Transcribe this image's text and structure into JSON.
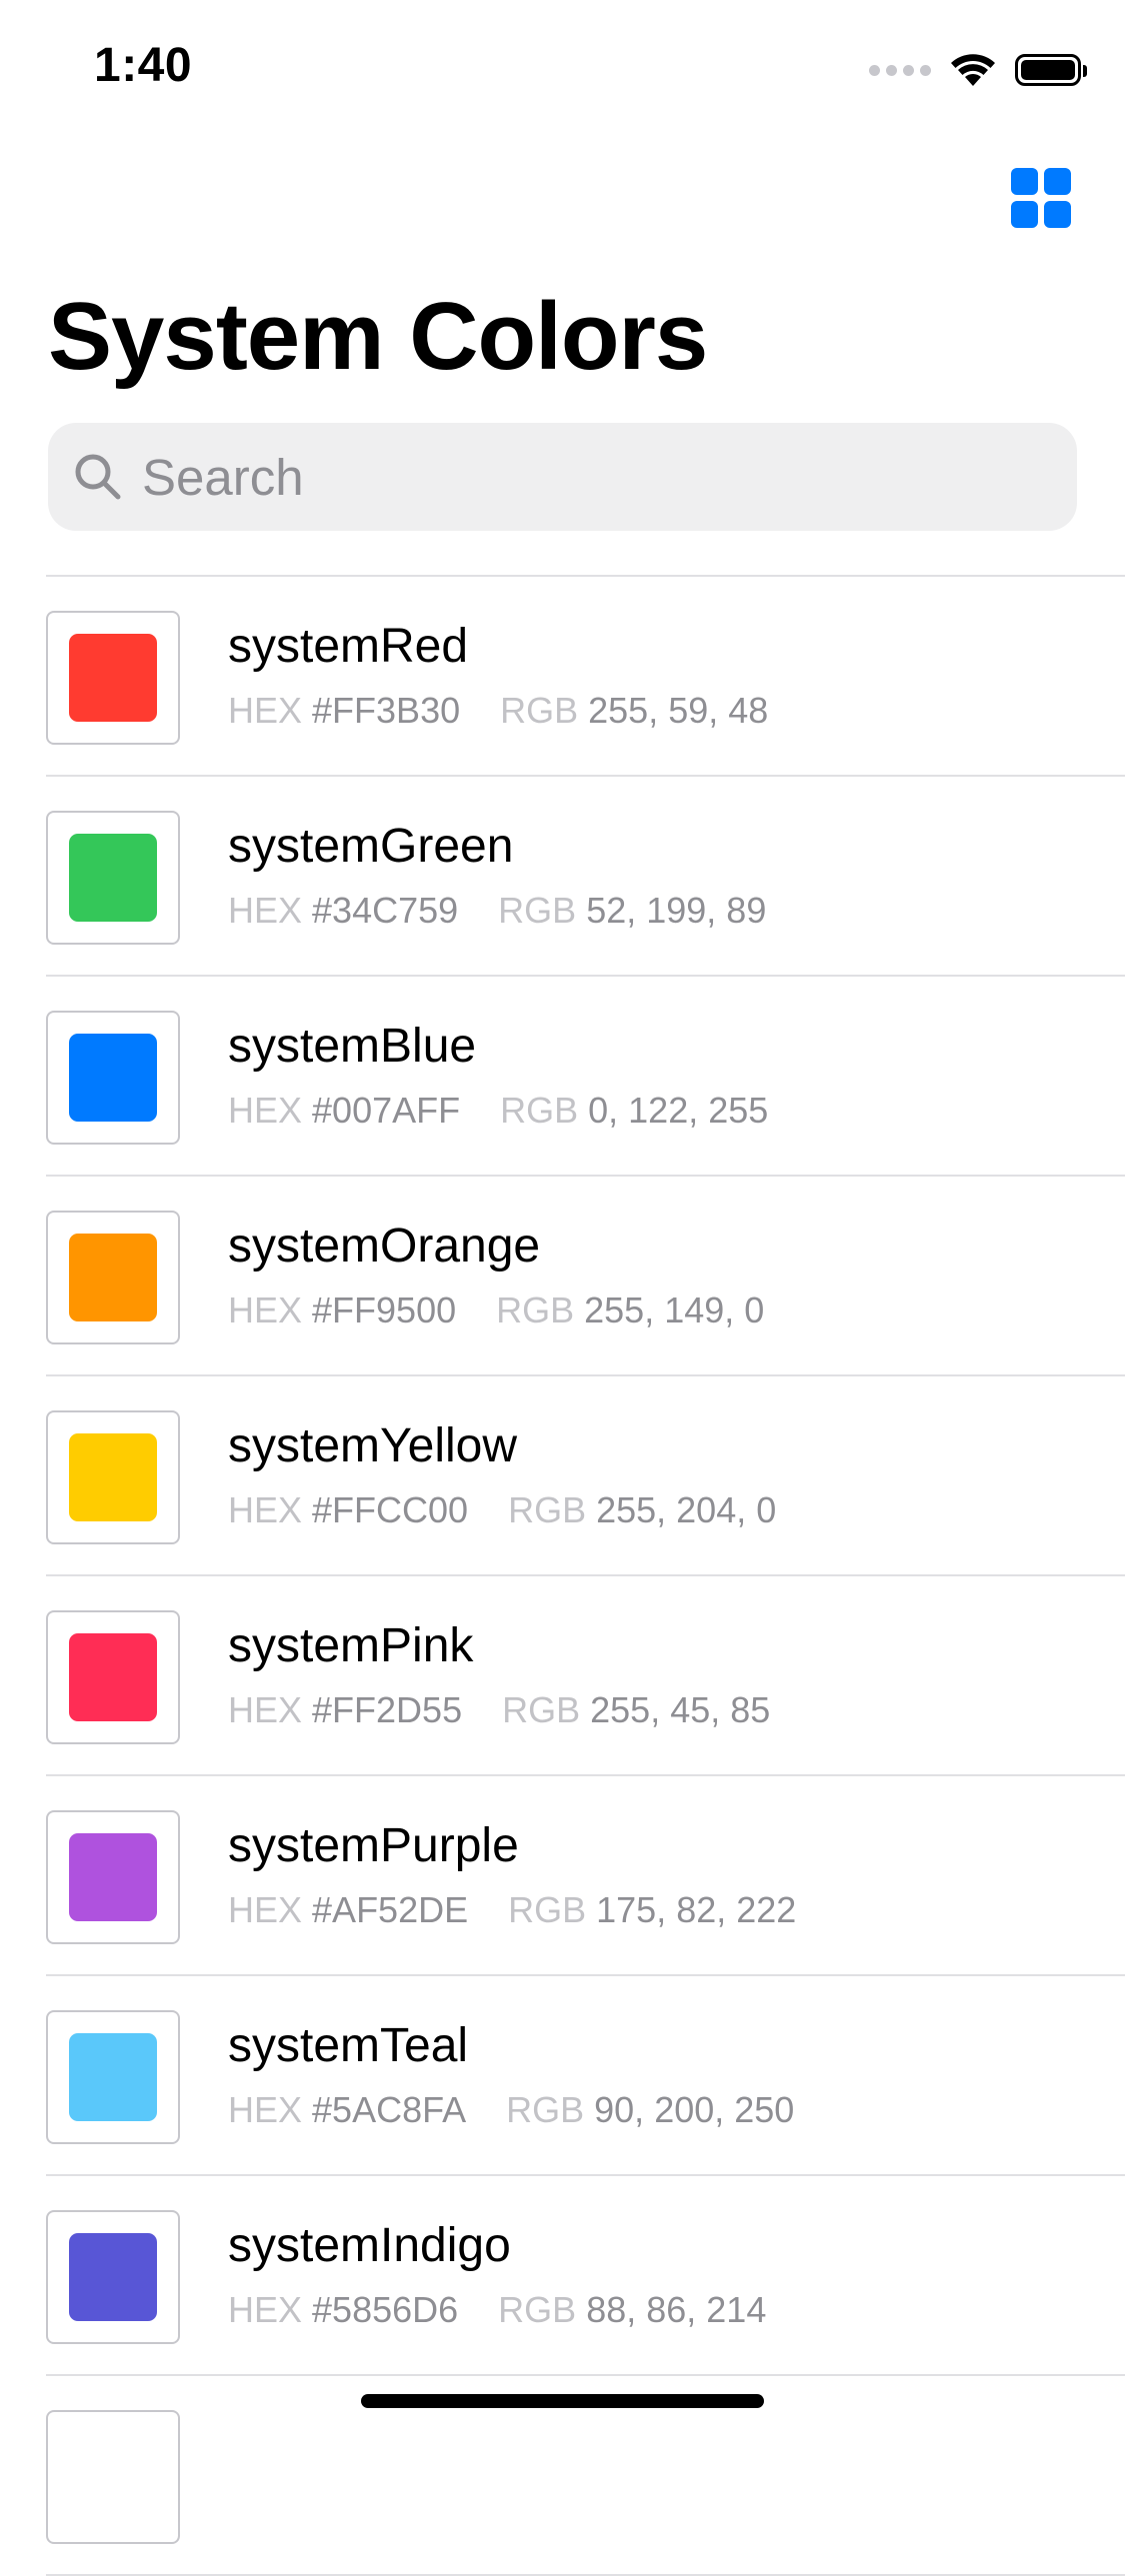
{
  "status_bar": {
    "time": "1:40"
  },
  "nav": {
    "title": "System Colors",
    "grid_icon": "grid-icon",
    "accent": "#007AFF"
  },
  "search": {
    "placeholder": "Search",
    "value": ""
  },
  "labels": {
    "hex": "HEX",
    "rgb": "RGB"
  },
  "colors": [
    {
      "name": "systemRed",
      "hex": "#FF3B30",
      "rgb": "255, 59, 48"
    },
    {
      "name": "systemGreen",
      "hex": "#34C759",
      "rgb": "52, 199, 89"
    },
    {
      "name": "systemBlue",
      "hex": "#007AFF",
      "rgb": "0, 122, 255"
    },
    {
      "name": "systemOrange",
      "hex": "#FF9500",
      "rgb": "255, 149, 0"
    },
    {
      "name": "systemYellow",
      "hex": "#FFCC00",
      "rgb": "255, 204, 0"
    },
    {
      "name": "systemPink",
      "hex": "#FF2D55",
      "rgb": "255, 45, 85"
    },
    {
      "name": "systemPurple",
      "hex": "#AF52DE",
      "rgb": "175, 82, 222"
    },
    {
      "name": "systemTeal",
      "hex": "#5AC8FA",
      "rgb": "90, 200, 250"
    },
    {
      "name": "systemIndigo",
      "hex": "#5856D6",
      "rgb": "88, 86, 214"
    }
  ]
}
